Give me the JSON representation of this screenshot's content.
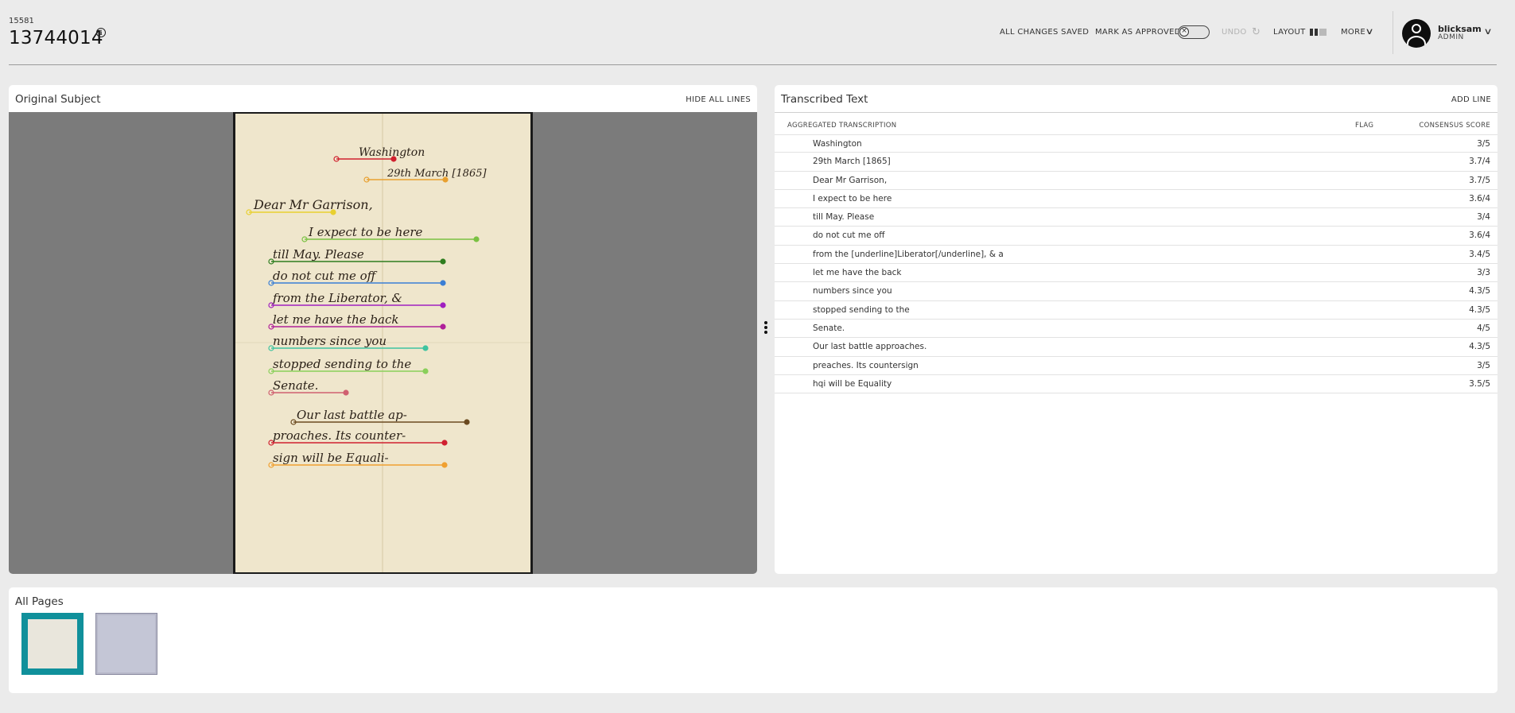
{
  "header": {
    "project_id": "15581",
    "subject_id": "13744014",
    "info_icon": "info-icon"
  },
  "toolbar": {
    "saved_status": "ALL CHANGES SAVED",
    "approve_label": "MARK AS APPROVED",
    "approve_toggle_icon": "x-icon",
    "approved": false,
    "undo_label": "UNDO",
    "layout_label": "LAYOUT",
    "more_label": "MORE"
  },
  "user": {
    "name": "blicksam",
    "role": "ADMIN"
  },
  "original_subject": {
    "title": "Original Subject",
    "hide_lines_label": "HIDE ALL LINES",
    "handwriting": [
      "Washington",
      "29th March [1865]",
      "Dear Mr Garrison,",
      "I expect to be here",
      "till May. Please",
      "do not cut me off",
      "from the Liberator, &",
      "let me have the back",
      "numbers since you",
      "stopped sending to the",
      "Senate.",
      "Our last battle ap-",
      "proaches. Its counter-",
      "sign will be Equali-"
    ],
    "line_colors": [
      "#d0202e",
      "#e8a030",
      "#e8d030",
      "#7ac142",
      "#2e7d1f",
      "#3a7fd5",
      "#a020c0",
      "#b0209a",
      "#3fc4a0",
      "#8acf5a",
      "#d06070",
      "#6b4a20",
      "#d02030",
      "#f0a030"
    ]
  },
  "transcribed_text": {
    "title": "Transcribed Text",
    "add_line_label": "ADD LINE",
    "columns": {
      "transcription": "AGGREGATED TRANSCRIPTION",
      "flag": "FLAG",
      "score": "CONSENSUS SCORE"
    },
    "rows": [
      {
        "text": "Washington",
        "score": "3/5"
      },
      {
        "text": "29th March [1865]",
        "score": "3.7/4"
      },
      {
        "text": "Dear Mr Garrison,",
        "score": "3.7/5"
      },
      {
        "text": "I expect to be here",
        "score": "3.6/4"
      },
      {
        "text": "till May. Please",
        "score": "3/4"
      },
      {
        "text": "do not cut me off",
        "score": "3.6/4"
      },
      {
        "text": "from the [underline]Liberator[/underline], & a",
        "score": "3.4/5"
      },
      {
        "text": "let me have the back",
        "score": "3/3"
      },
      {
        "text": "numbers since you",
        "score": "4.3/5"
      },
      {
        "text": "stopped sending to the",
        "score": "4.3/5"
      },
      {
        "text": "Senate.",
        "score": "4/5"
      },
      {
        "text": "Our last battle approaches.",
        "score": "4.3/5"
      },
      {
        "text": "preaches. Its countersign",
        "score": "3/5"
      },
      {
        "text": "hqi will be Equality",
        "score": "3.5/5"
      }
    ]
  },
  "all_pages": {
    "title": "All Pages"
  }
}
